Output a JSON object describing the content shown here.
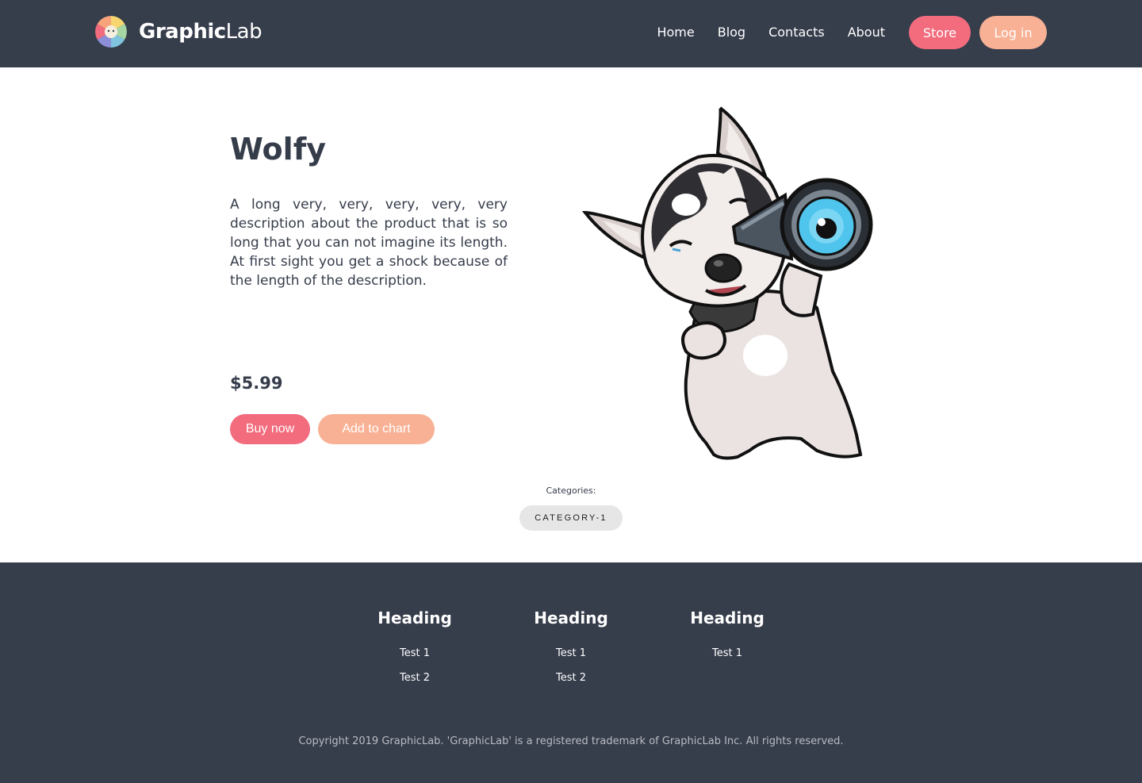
{
  "header": {
    "brand_bold": "Graphic",
    "brand_light": "Lab",
    "nav": [
      "Home",
      "Blog",
      "Contacts",
      "About"
    ],
    "store_label": "Store",
    "login_label": "Log in"
  },
  "product": {
    "title": "Wolfy",
    "description": "A long very, very, very, very, very description about the product that is so long that you can not imagine its length. At first sight you get a shock because of the length of the description.",
    "price": "$5.99",
    "buy_label": "Buy now",
    "cart_label": "Add to chart",
    "image_icon": "husky-with-telescope-illustration"
  },
  "categories": {
    "label": "Categories:",
    "items": [
      "CATEGORY-1"
    ]
  },
  "footer": {
    "columns": [
      {
        "heading": "Heading",
        "links": [
          "Test 1",
          "Test 2"
        ]
      },
      {
        "heading": "Heading",
        "links": [
          "Test 1",
          "Test 2"
        ]
      },
      {
        "heading": "Heading",
        "links": [
          "Test 1"
        ]
      }
    ],
    "copyright": "Copyright 2019 GraphicLab. 'GraphicLab' is a registered trademark of GraphicLab Inc. All rights reserved."
  },
  "colors": {
    "header_bg": "#363d4b",
    "accent_pink": "#f26c7d",
    "accent_peach": "#f8b195",
    "text_dark": "#353c4a"
  }
}
